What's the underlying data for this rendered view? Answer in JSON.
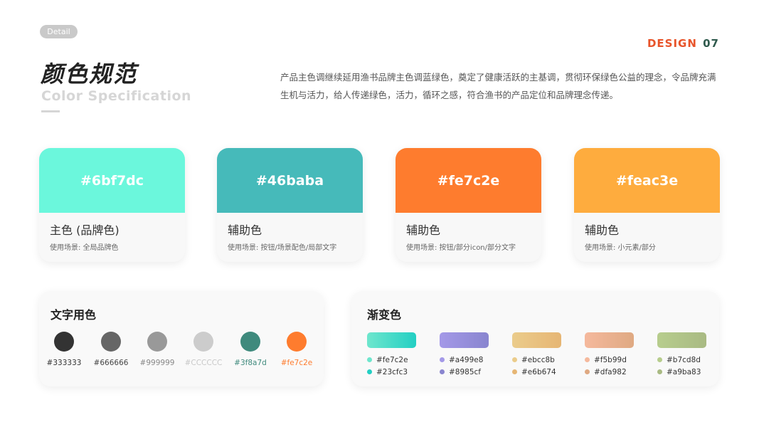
{
  "header": {
    "badge": "Detail",
    "page_label": "DESIGN",
    "page_number": "07",
    "title_zh": "颜色规范",
    "title_en": "Color Specification",
    "intro": "产品主色调继续延用渔书品牌主色调蓝绿色，奠定了健康活跃的主基调，贯彻环保绿色公益的理念，令品牌充满生机与活力，给人传递绿色，活力，循环之感，符合渔书的产品定位和品牌理念传递。"
  },
  "swatches": [
    {
      "hex_label": "#6bf7dc",
      "color": "#6bf7dc",
      "role": "主色 (品牌色)",
      "usage": "使用场景: 全局品牌色"
    },
    {
      "hex_label": "#46baba",
      "color": "#46baba",
      "role": "辅助色",
      "usage": "使用场景: 按钮/场景配色/局部文字"
    },
    {
      "hex_label": "#fe7c2e",
      "color": "#fe7c2e",
      "role": "辅助色",
      "usage": "使用场景: 按钮/部分icon/部分文字"
    },
    {
      "hex_label": "#feac3e",
      "color": "#feac3e",
      "role": "辅助色",
      "usage": "使用场景: 小元素/部分"
    }
  ],
  "text_colors": {
    "title": "文字用色",
    "items": [
      {
        "hex": "#333333",
        "color": "#333333",
        "label_color": "#333333"
      },
      {
        "hex": "#666666",
        "color": "#666666",
        "label_color": "#444444"
      },
      {
        "hex": "#999999",
        "color": "#999999",
        "label_color": "#888888"
      },
      {
        "hex": "#CCCCCC",
        "color": "#cccccc",
        "label_color": "#c8c8c8"
      },
      {
        "hex": "#3f8a7d",
        "color": "#3f8a7d",
        "label_color": "#3f8a7d"
      },
      {
        "hex": "#fe7c2e",
        "color": "#fe7c2e",
        "label_color": "#fe7c2e"
      }
    ]
  },
  "gradients": {
    "title": "渐变色",
    "items": [
      {
        "from": "#fe7c2e",
        "to": "#23cfc3",
        "bar_from": "#6ee6cd",
        "bar_to": "#23cfc3",
        "dot_from": "#6ee6cd",
        "dot_to": "#23cfc3"
      },
      {
        "from": "#a499e8",
        "to": "#8985cf",
        "bar_from": "#a499e8",
        "bar_to": "#8985cf",
        "dot_from": "#a499e8",
        "dot_to": "#8985cf"
      },
      {
        "from": "#ebcc8b",
        "to": "#e6b674",
        "bar_from": "#ebcc8b",
        "bar_to": "#e6b674",
        "dot_from": "#ebcc8b",
        "dot_to": "#e6b674"
      },
      {
        "from": "#f5b99d",
        "to": "#dfa982",
        "bar_from": "#f5b99d",
        "bar_to": "#dfa982",
        "dot_from": "#f5b99d",
        "dot_to": "#dfa982"
      },
      {
        "from": "#b7cd8d",
        "to": "#a9ba83",
        "bar_from": "#b7cd8d",
        "bar_to": "#a9ba83",
        "dot_from": "#b7cd8d",
        "dot_to": "#a9ba83"
      }
    ]
  }
}
